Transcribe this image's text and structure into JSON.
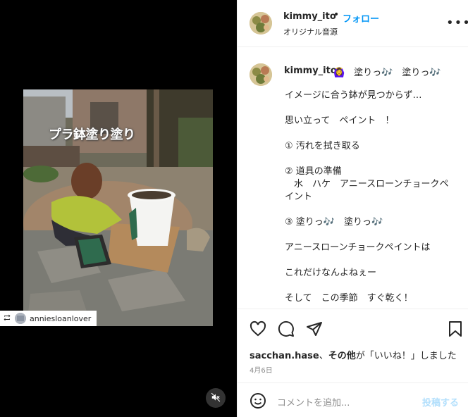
{
  "media": {
    "overlay_text": "プラ鉢塗り塗り",
    "repost_user": "anniesloanlover"
  },
  "header": {
    "username": "kimmy_ito",
    "separator": "•",
    "follow_label": "フォロー",
    "audio_label": "オリジナル音源",
    "more_label": "•••"
  },
  "caption": {
    "username": "kimmy_ito",
    "first_line": "🙆‍♀️　塗りっ🎶　塗りっ🎶",
    "lines": [
      "イメージに合う鉢が見つからず…",
      "思い立って　ペイント　！",
      "① 汚れを拭き取る",
      "② 道具の準備",
      "　水　ハケ　アニースローンチョークペ",
      "イント",
      "③ 塗りっ🎶　塗りっ🎶",
      "アニースローンチョークペイントは",
      "これだけなんよねぇー",
      "そして　この季節　すぐ乾く！"
    ]
  },
  "likes": {
    "user": "sacchan.hase",
    "sep": "、",
    "others": "その他",
    "suffix": "が「いいね！」しました"
  },
  "date": "4月6日",
  "comment": {
    "placeholder": "コメントを追加...",
    "post_label": "投稿する"
  }
}
